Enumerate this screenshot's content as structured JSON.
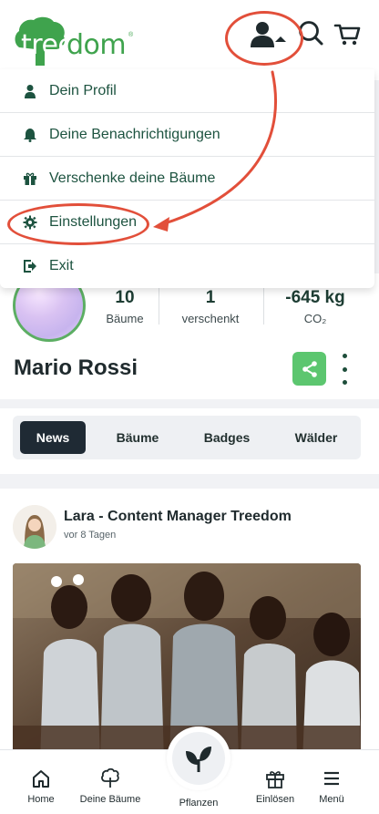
{
  "brand": {
    "logo_text_white": "tree",
    "logo_text_green": "dom",
    "logo_reg": "®"
  },
  "header": {
    "profile_icon": "user-menu-icon",
    "search_icon": "search-icon",
    "cart_icon": "cart-icon"
  },
  "menu": {
    "items": [
      {
        "label": "Dein Profil",
        "icon": "person-icon"
      },
      {
        "label": "Deine Benachrichtigungen",
        "icon": "bell-icon"
      },
      {
        "label": "Verschenke deine Bäume",
        "icon": "gift-icon"
      },
      {
        "label": "Einstellungen",
        "icon": "gear-icon"
      },
      {
        "label": "Exit",
        "icon": "exit-icon"
      }
    ]
  },
  "profile": {
    "name": "Mario Rossi",
    "stats": [
      {
        "value": "10",
        "label": "Bäume"
      },
      {
        "value": "1",
        "label": "verschenkt"
      },
      {
        "value": "-645 kg",
        "label": "CO₂"
      }
    ]
  },
  "tabs": [
    {
      "label": "News",
      "active": true
    },
    {
      "label": "Bäume",
      "active": false
    },
    {
      "label": "Badges",
      "active": false
    },
    {
      "label": "Wälder",
      "active": false
    }
  ],
  "post": {
    "author": "Lara - Content Manager Treedom",
    "time": "vor 8 Tagen"
  },
  "bottom_nav": [
    {
      "label": "Home",
      "icon": "home-icon"
    },
    {
      "label": "Deine Bäume",
      "icon": "tree-icon"
    },
    {
      "label": "Pflanzen",
      "icon": "sprout-icon"
    },
    {
      "label": "Einlösen",
      "icon": "gift-icon"
    },
    {
      "label": "Menü",
      "icon": "hamburger-icon"
    }
  ],
  "colors": {
    "brand_green": "#3fa34d",
    "dark_green": "#1d5340",
    "annotation_red": "#e24f3a",
    "share_green": "#5cc66f",
    "active_tab": "#1f2a34"
  }
}
